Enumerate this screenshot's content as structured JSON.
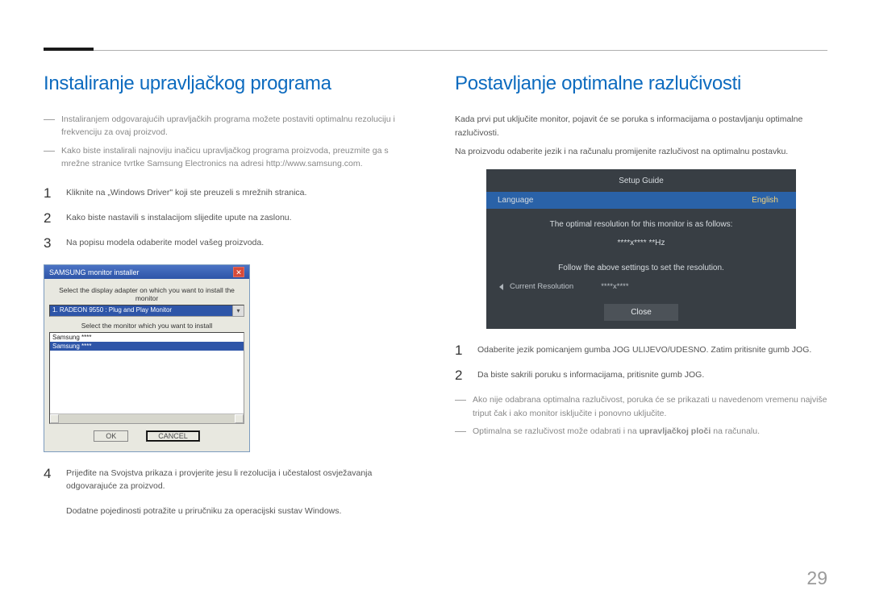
{
  "pageNumber": "29",
  "left": {
    "heading": "Instaliranje upravljačkog programa",
    "dashes": [
      "Instaliranjem odgovarajućih upravljačkih programa možete postaviti optimalnu rezoluciju i frekvenciju za ovaj proizvod.",
      "Kako biste instalirali najnoviju inačicu upravljačkog programa proizvoda, preuzmite ga s mrežne stranice tvrtke Samsung Electronics na adresi http://www.samsung.com."
    ],
    "steps": [
      "Kliknite na „Windows Driver\" koji ste preuzeli s mrežnih stranica.",
      "Kako biste nastavili s instalacijom slijedite upute na zaslonu.",
      "Na popisu modela odaberite model vašeg proizvoda."
    ],
    "dialog": {
      "title": "SAMSUNG monitor installer",
      "label1": "Select the display adapter on which you want to install the monitor",
      "adapter": "1. RADEON 9550 : Plug and Play Monitor",
      "label2": "Select the monitor which you want to install",
      "listItems": [
        "Samsung ****",
        "Samsung ****"
      ],
      "ok": "OK",
      "cancel": "CANCEL"
    },
    "step4": "Prijeđite na Svojstva prikaza i provjerite jesu li rezolucija i učestalost osvježavanja odgovarajuće za proizvod.",
    "step4b": "Dodatne pojedinosti potražite u priručniku za operacijski sustav Windows."
  },
  "right": {
    "heading": "Postavljanje optimalne razlučivosti",
    "intro1": "Kada prvi put uključite monitor, pojavit će se poruka s informacijama o postavljanju optimalne razlučivosti.",
    "intro2": "Na proizvodu odaberite jezik i na računalu promijenite razlučivost na optimalnu postavku.",
    "osd": {
      "title": "Setup Guide",
      "langLabel": "Language",
      "langValue": "English",
      "line1": "The optimal resolution for this monitor is as follows:",
      "resLine": "****x**** **Hz",
      "line2": "Follow the above settings to set the resolution.",
      "curResLabel": "Current Resolution",
      "curResValue": "****x****",
      "close": "Close"
    },
    "steps": [
      "Odaberite jezik pomicanjem gumba JOG ULIJEVO/UDESNO. Zatim pritisnite gumb JOG.",
      "Da biste sakrili poruku s informacijama, pritisnite gumb JOG."
    ],
    "dashes": [
      "Ako nije odabrana optimalna razlučivost, poruka će se prikazati u navedenom vremenu najviše triput čak i ako monitor isključite i ponovno uključite."
    ],
    "dash2a": "Optimalna se razlučivost može odabrati i na ",
    "dash2bold": "upravljačkoj ploči",
    "dash2b": " na računalu."
  }
}
